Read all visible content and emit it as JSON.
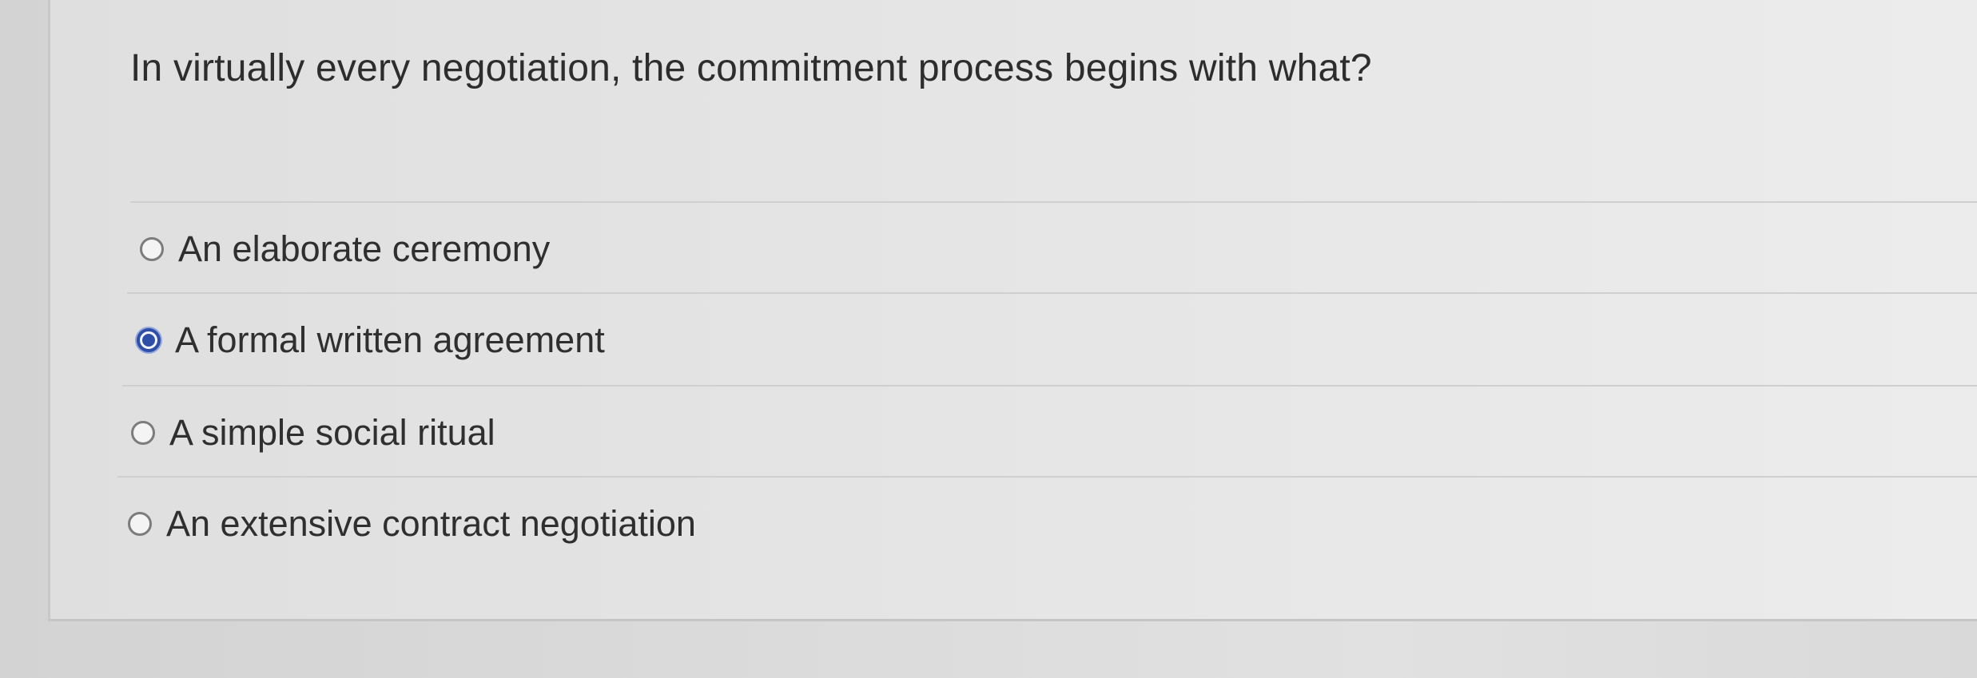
{
  "question": {
    "text": "In virtually every negotiation, the commitment process begins with what?"
  },
  "answers": [
    {
      "label": "An elaborate ceremony",
      "selected": false
    },
    {
      "label": "A formal written agreement",
      "selected": true
    },
    {
      "label": "A simple social ritual",
      "selected": false
    },
    {
      "label": "An extensive contract negotiation",
      "selected": false
    }
  ],
  "colors": {
    "selected_radio": "#2f4ea7",
    "text": "#2f2f2f",
    "background": "#e3e3e3"
  }
}
